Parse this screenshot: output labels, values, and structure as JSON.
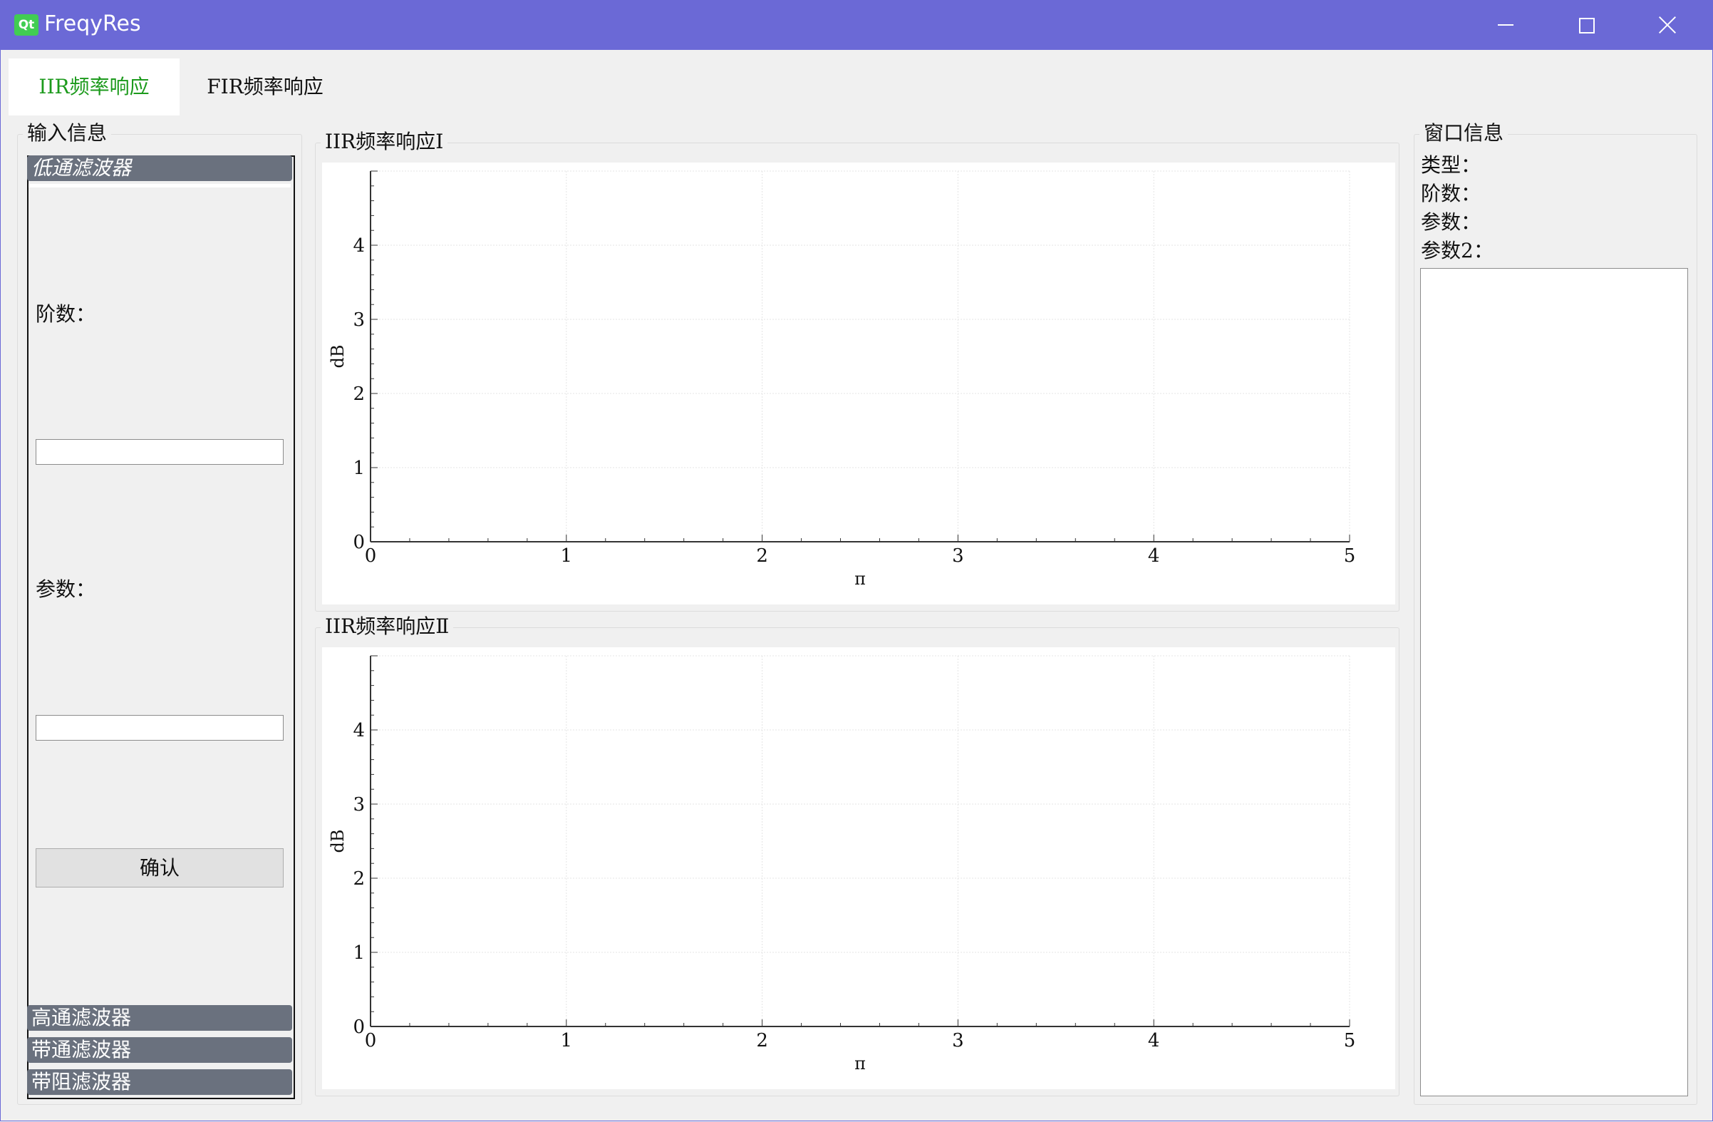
{
  "window": {
    "title": "FreqyRes",
    "logo_text": "Qt",
    "title_bar_color": "#6b69d6"
  },
  "tabs": [
    {
      "label": "IIR频率响应",
      "selected": true
    },
    {
      "label": "FIR频率响应",
      "selected": false
    }
  ],
  "input_panel": {
    "title": "输入信息",
    "toolbox": [
      {
        "label": "低通滤波器",
        "expanded": true
      },
      {
        "label": "高通滤波器",
        "expanded": false
      },
      {
        "label": "带通滤波器",
        "expanded": false
      },
      {
        "label": "带阻滤波器",
        "expanded": false
      }
    ],
    "order_label": "阶数：",
    "order_value": "",
    "param_label": "参数：",
    "param_value": "",
    "confirm_label": "确认"
  },
  "info_panel": {
    "title": "窗口信息",
    "type_label": "类型：",
    "order_label": "阶数：",
    "param_label": "参数：",
    "param2_label": "参数2：",
    "text_content": ""
  },
  "charts": [
    {
      "title": "IIR频率响应Ⅰ"
    },
    {
      "title": "IIR频率响应Ⅱ"
    }
  ],
  "chart_data": [
    {
      "type": "line",
      "title": "IIR频率响应Ⅰ",
      "xlabel": "π",
      "ylabel": "dB",
      "xlim": [
        0,
        5
      ],
      "ylim": [
        0,
        5
      ],
      "xticks": [
        "0",
        "1",
        "2",
        "3",
        "4",
        "5"
      ],
      "yticks": [
        "0",
        "1",
        "2",
        "3",
        "4"
      ],
      "grid": true,
      "series": []
    },
    {
      "type": "line",
      "title": "IIR频率响应Ⅱ",
      "xlabel": "π",
      "ylabel": "dB",
      "xlim": [
        0,
        5
      ],
      "ylim": [
        0,
        5
      ],
      "xticks": [
        "0",
        "1",
        "2",
        "3",
        "4",
        "5"
      ],
      "yticks": [
        "0",
        "1",
        "2",
        "3",
        "4"
      ],
      "grid": true,
      "series": []
    }
  ]
}
